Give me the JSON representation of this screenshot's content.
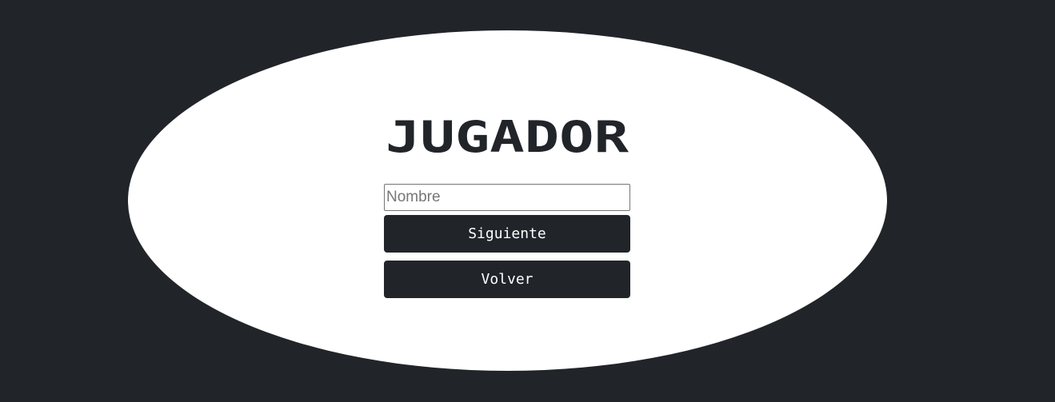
{
  "title": "JUGADOR",
  "form": {
    "name_value": "",
    "name_placeholder": "Nombre",
    "next_label": "Siguiente",
    "back_label": "Volver"
  },
  "colors": {
    "background": "#212529",
    "panel": "#ffffff",
    "button": "#212529",
    "button_text": "#ffffff"
  }
}
